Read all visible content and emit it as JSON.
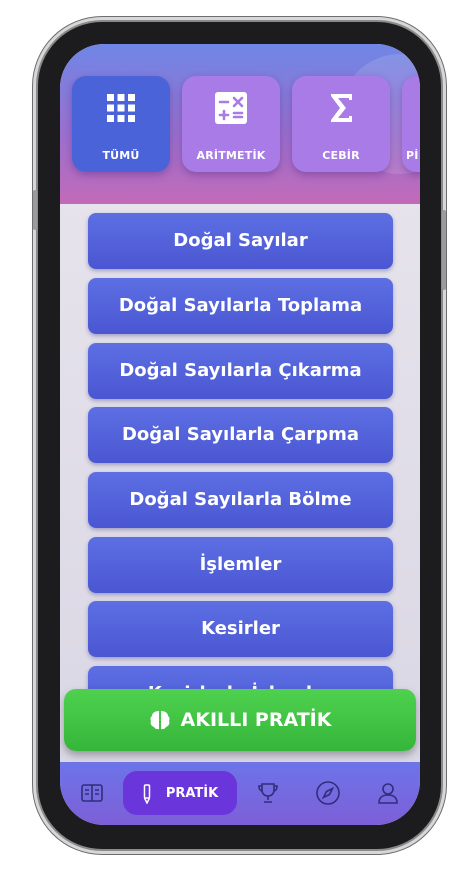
{
  "categories": [
    {
      "label": "TÜMÜ",
      "icon": "grid-icon",
      "active": true
    },
    {
      "label": "ARİTMETİK",
      "icon": "calculator-icon",
      "active": false
    },
    {
      "label": "CEBİR",
      "icon": "sigma-icon",
      "active": false
    },
    {
      "label": "Pİ",
      "icon": "partial-icon",
      "active": false
    }
  ],
  "topics": [
    "Doğal Sayılar",
    "Doğal Sayılarla Toplama",
    "Doğal Sayılarla Çıkarma",
    "Doğal Sayılarla Çarpma",
    "Doğal Sayılarla Bölme",
    "İşlemler",
    "Kesirler",
    "Kesirlerle İşlemler"
  ],
  "fab": {
    "label": "AKILLI PRATİK",
    "icon": "brain-icon",
    "color": "#3cc140"
  },
  "nav": {
    "active_label": "PRATİK",
    "items": [
      "book-icon",
      "pencil-icon",
      "trophy-icon",
      "compass-icon",
      "user-icon"
    ]
  },
  "colors": {
    "accent": "#4b63d9",
    "purple": "#a87be6",
    "green": "#3cc140"
  }
}
